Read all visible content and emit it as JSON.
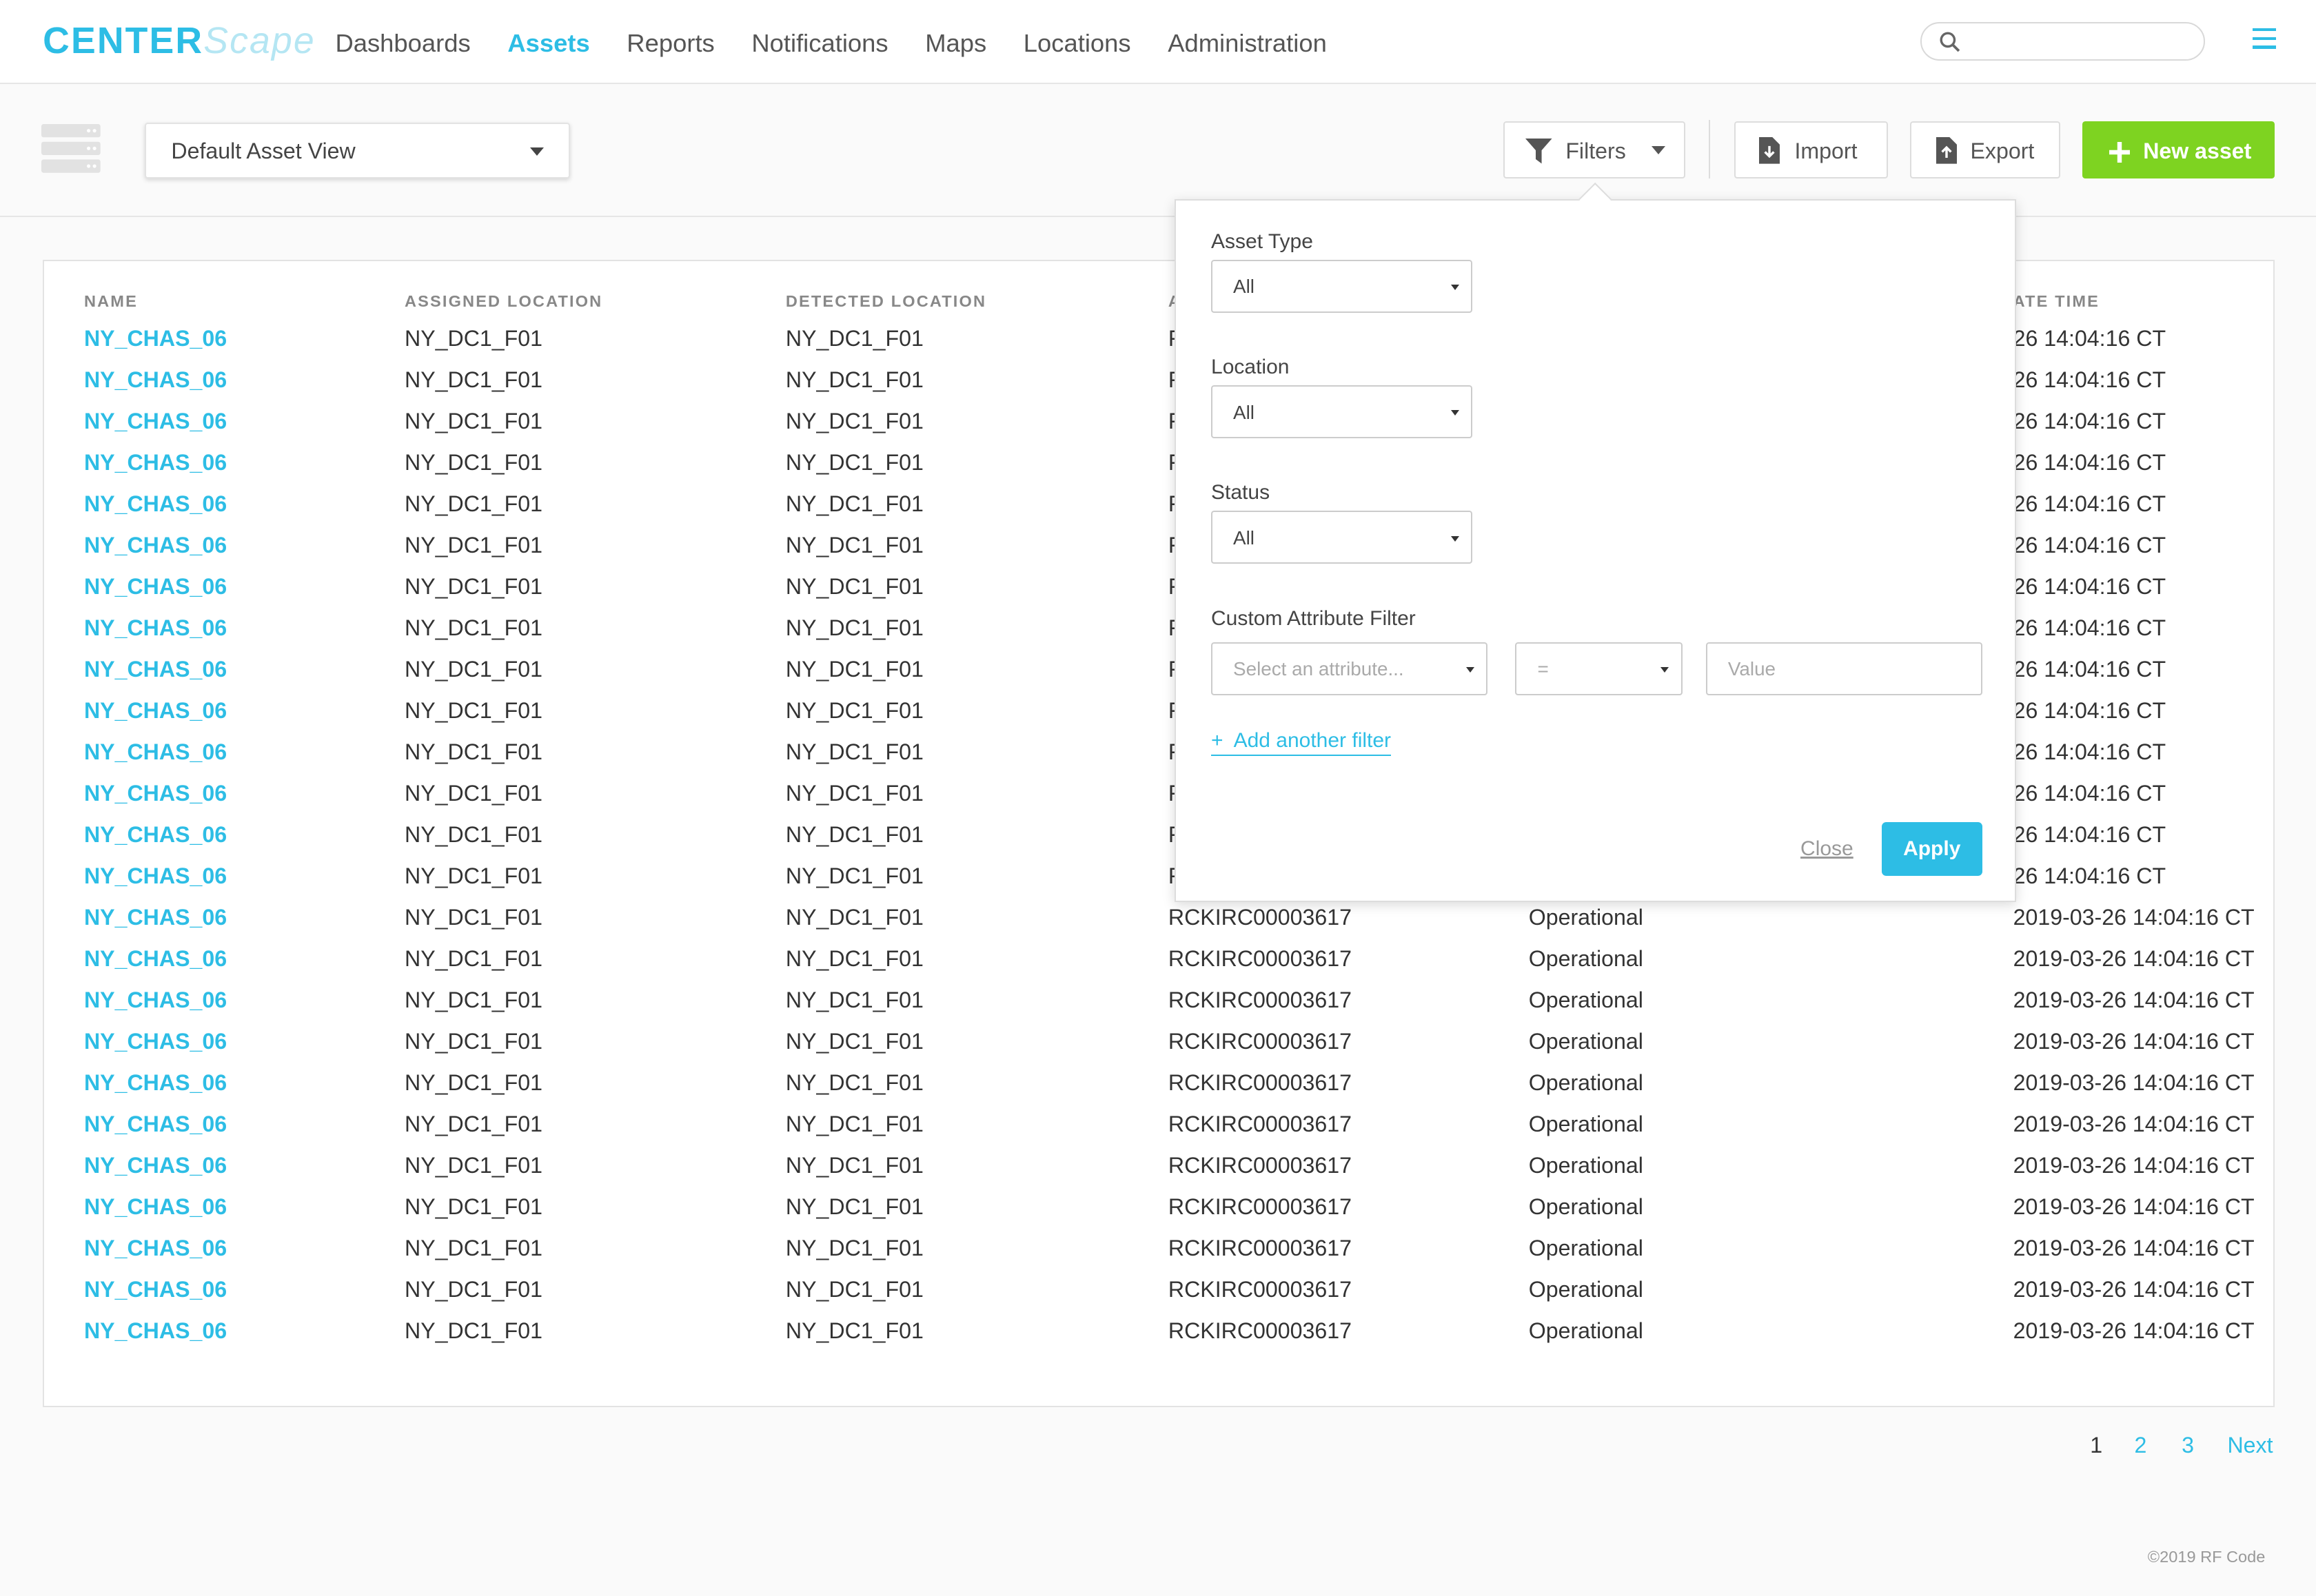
{
  "brand": {
    "part1": "CENTER",
    "part2": "Scape"
  },
  "nav": {
    "items": [
      "Dashboards",
      "Assets",
      "Reports",
      "Notifications",
      "Maps",
      "Locations",
      "Administration"
    ],
    "active": "Assets"
  },
  "toolbar": {
    "view_select": "Default Asset View",
    "filters_label": "Filters",
    "import_label": "Import",
    "export_label": "Export",
    "new_asset_label": "New asset"
  },
  "table": {
    "columns": [
      "NAME",
      "ASSIGNED LOCATION",
      "DETECTED LOCATION",
      "A",
      "",
      "ATE TIME"
    ],
    "rows": [
      {
        "name": "NY_CHAS_06",
        "assigned": "NY_DC1_F01",
        "detected": "NY_DC1_F01",
        "asset": "F",
        "status": "",
        "time": "26 14:04:16 CT"
      },
      {
        "name": "NY_CHAS_06",
        "assigned": "NY_DC1_F01",
        "detected": "NY_DC1_F01",
        "asset": "F",
        "status": "",
        "time": "26 14:04:16 CT"
      },
      {
        "name": "NY_CHAS_06",
        "assigned": "NY_DC1_F01",
        "detected": "NY_DC1_F01",
        "asset": "F",
        "status": "",
        "time": "26 14:04:16 CT"
      },
      {
        "name": "NY_CHAS_06",
        "assigned": "NY_DC1_F01",
        "detected": "NY_DC1_F01",
        "asset": "F",
        "status": "",
        "time": "26 14:04:16 CT"
      },
      {
        "name": "NY_CHAS_06",
        "assigned": "NY_DC1_F01",
        "detected": "NY_DC1_F01",
        "asset": "F",
        "status": "",
        "time": "26 14:04:16 CT"
      },
      {
        "name": "NY_CHAS_06",
        "assigned": "NY_DC1_F01",
        "detected": "NY_DC1_F01",
        "asset": "F",
        "status": "",
        "time": "26 14:04:16 CT"
      },
      {
        "name": "NY_CHAS_06",
        "assigned": "NY_DC1_F01",
        "detected": "NY_DC1_F01",
        "asset": "F",
        "status": "",
        "time": "26 14:04:16 CT"
      },
      {
        "name": "NY_CHAS_06",
        "assigned": "NY_DC1_F01",
        "detected": "NY_DC1_F01",
        "asset": "F",
        "status": "",
        "time": "26 14:04:16 CT"
      },
      {
        "name": "NY_CHAS_06",
        "assigned": "NY_DC1_F01",
        "detected": "NY_DC1_F01",
        "asset": "F",
        "status": "",
        "time": "26 14:04:16 CT"
      },
      {
        "name": "NY_CHAS_06",
        "assigned": "NY_DC1_F01",
        "detected": "NY_DC1_F01",
        "asset": "F",
        "status": "",
        "time": "26 14:04:16 CT"
      },
      {
        "name": "NY_CHAS_06",
        "assigned": "NY_DC1_F01",
        "detected": "NY_DC1_F01",
        "asset": "F",
        "status": "",
        "time": "26 14:04:16 CT"
      },
      {
        "name": "NY_CHAS_06",
        "assigned": "NY_DC1_F01",
        "detected": "NY_DC1_F01",
        "asset": "F",
        "status": "",
        "time": "26 14:04:16 CT"
      },
      {
        "name": "NY_CHAS_06",
        "assigned": "NY_DC1_F01",
        "detected": "NY_DC1_F01",
        "asset": "F",
        "status": "",
        "time": "26 14:04:16 CT"
      },
      {
        "name": "NY_CHAS_06",
        "assigned": "NY_DC1_F01",
        "detected": "NY_DC1_F01",
        "asset": "F",
        "status": "",
        "time": "26 14:04:16 CT"
      },
      {
        "name": "NY_CHAS_06",
        "assigned": "NY_DC1_F01",
        "detected": "NY_DC1_F01",
        "asset": "RCKIRC00003617",
        "status": "Operational",
        "time": "2019-03-26 14:04:16 CT"
      },
      {
        "name": "NY_CHAS_06",
        "assigned": "NY_DC1_F01",
        "detected": "NY_DC1_F01",
        "asset": "RCKIRC00003617",
        "status": "Operational",
        "time": "2019-03-26 14:04:16 CT"
      },
      {
        "name": "NY_CHAS_06",
        "assigned": "NY_DC1_F01",
        "detected": "NY_DC1_F01",
        "asset": "RCKIRC00003617",
        "status": "Operational",
        "time": "2019-03-26 14:04:16 CT"
      },
      {
        "name": "NY_CHAS_06",
        "assigned": "NY_DC1_F01",
        "detected": "NY_DC1_F01",
        "asset": "RCKIRC00003617",
        "status": "Operational",
        "time": "2019-03-26 14:04:16 CT"
      },
      {
        "name": "NY_CHAS_06",
        "assigned": "NY_DC1_F01",
        "detected": "NY_DC1_F01",
        "asset": "RCKIRC00003617",
        "status": "Operational",
        "time": "2019-03-26 14:04:16 CT"
      },
      {
        "name": "NY_CHAS_06",
        "assigned": "NY_DC1_F01",
        "detected": "NY_DC1_F01",
        "asset": "RCKIRC00003617",
        "status": "Operational",
        "time": "2019-03-26 14:04:16 CT"
      },
      {
        "name": "NY_CHAS_06",
        "assigned": "NY_DC1_F01",
        "detected": "NY_DC1_F01",
        "asset": "RCKIRC00003617",
        "status": "Operational",
        "time": "2019-03-26 14:04:16 CT"
      },
      {
        "name": "NY_CHAS_06",
        "assigned": "NY_DC1_F01",
        "detected": "NY_DC1_F01",
        "asset": "RCKIRC00003617",
        "status": "Operational",
        "time": "2019-03-26 14:04:16 CT"
      },
      {
        "name": "NY_CHAS_06",
        "assigned": "NY_DC1_F01",
        "detected": "NY_DC1_F01",
        "asset": "RCKIRC00003617",
        "status": "Operational",
        "time": "2019-03-26 14:04:16 CT"
      },
      {
        "name": "NY_CHAS_06",
        "assigned": "NY_DC1_F01",
        "detected": "NY_DC1_F01",
        "asset": "RCKIRC00003617",
        "status": "Operational",
        "time": "2019-03-26 14:04:16 CT"
      },
      {
        "name": "NY_CHAS_06",
        "assigned": "NY_DC1_F01",
        "detected": "NY_DC1_F01",
        "asset": "RCKIRC00003617",
        "status": "Operational",
        "time": "2019-03-26 14:04:16 CT"
      }
    ]
  },
  "pagination": {
    "current": "1",
    "pages": [
      "2",
      "3"
    ],
    "next": "Next"
  },
  "footer": "©2019 RF Code",
  "filters_panel": {
    "asset_type_label": "Asset Type",
    "asset_type_value": "All",
    "location_label": "Location",
    "location_value": "All",
    "status_label": "Status",
    "status_value": "All",
    "custom_label": "Custom Attribute Filter",
    "attribute_placeholder": "Select an attribute...",
    "operator_value": "=",
    "value_placeholder": "Value",
    "add_filter": "Add another filter",
    "add_filter_prefix": "+",
    "close_label": "Close",
    "apply_label": "Apply"
  },
  "colors": {
    "accent": "#2dbde5",
    "new_button": "#7ed321"
  },
  "icons": [
    "search-icon",
    "menu-icon",
    "server-rack-icon",
    "filter-icon",
    "import-file-icon",
    "export-file-icon",
    "plus-icon"
  ]
}
